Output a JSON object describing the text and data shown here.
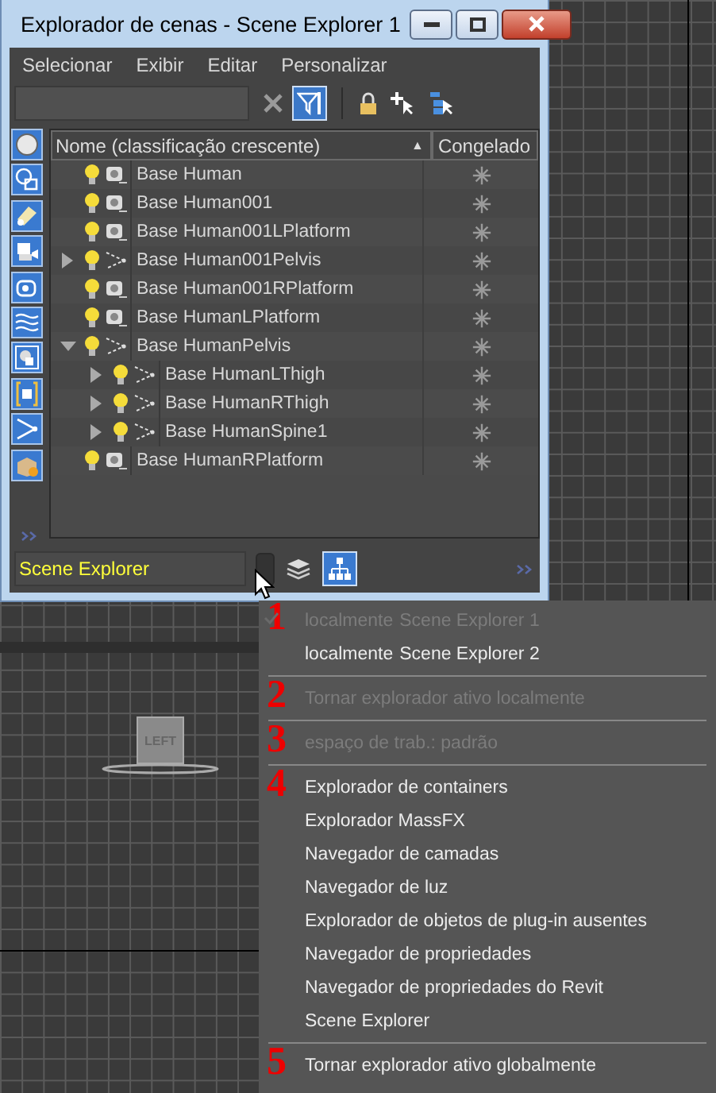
{
  "window": {
    "title": "Explorador de cenas - Scene Explorer 1"
  },
  "menubar": [
    "Selecionar",
    "Exibir",
    "Editar",
    "Personalizar"
  ],
  "toolbar": {
    "filter_on": true
  },
  "filters": [
    {
      "kind": "geometry",
      "on": true
    },
    {
      "kind": "shape",
      "on": true
    },
    {
      "kind": "light",
      "on": true
    },
    {
      "kind": "camera",
      "on": true
    },
    {
      "kind": "helper",
      "on": true
    },
    {
      "kind": "spacewarp",
      "on": true
    },
    {
      "kind": "group",
      "on": true
    },
    {
      "kind": "container",
      "on": true
    },
    {
      "kind": "bone",
      "on": true
    },
    {
      "kind": "xref",
      "on": true
    }
  ],
  "columns": [
    {
      "label": "Nome (classificação crescente)",
      "sort_mark": "▲"
    },
    {
      "label": "Congelado"
    }
  ],
  "rows": [
    {
      "name": "Base Human",
      "kind": "geometry",
      "frozen": false
    },
    {
      "name": "Base Human001",
      "kind": "geometry",
      "frozen": false
    },
    {
      "name": "Base Human001LPlatform",
      "kind": "geometry",
      "frozen": false
    },
    {
      "name": "Base Human001Pelvis",
      "kind": "bone",
      "frozen": false,
      "expanded": false
    },
    {
      "name": "Base Human001RPlatform",
      "kind": "geometry",
      "frozen": false
    },
    {
      "name": "Base HumanLPlatform",
      "kind": "geometry",
      "frozen": false
    },
    {
      "name": "Base HumanPelvis",
      "kind": "bone",
      "frozen": false,
      "expanded": true,
      "children": [
        {
          "name": "Base HumanLThigh",
          "kind": "bone",
          "frozen": false,
          "expanded": false
        },
        {
          "name": "Base HumanRThigh",
          "kind": "bone",
          "frozen": false,
          "expanded": false
        },
        {
          "name": "Base HumanSpine1",
          "kind": "bone",
          "frozen": false,
          "expanded": false
        }
      ]
    },
    {
      "name": "Base HumanRPlatform",
      "kind": "geometry",
      "frozen": false
    }
  ],
  "bottom": {
    "explorer_name": "Scene Explorer",
    "views": [
      {
        "kind": "layers",
        "selected": false
      },
      {
        "kind": "hierarchy",
        "selected": true
      }
    ]
  },
  "context_menu": [
    {
      "kind": "item",
      "marker": "1",
      "checked": true,
      "disabled": true,
      "prefix": "localmente",
      "label": "Scene Explorer 1"
    },
    {
      "kind": "item",
      "checked": false,
      "disabled": false,
      "prefix": "localmente",
      "label": "Scene Explorer 2"
    },
    {
      "kind": "separator"
    },
    {
      "kind": "item",
      "marker": "2",
      "checked": false,
      "disabled": true,
      "label": "Tornar explorador ativo localmente"
    },
    {
      "kind": "separator"
    },
    {
      "kind": "item",
      "marker": "3",
      "checked": false,
      "disabled": true,
      "label": "espaço de trab.: padrão"
    },
    {
      "kind": "separator"
    },
    {
      "kind": "item",
      "marker": "4",
      "checked": false,
      "disabled": false,
      "label": "Explorador de containers"
    },
    {
      "kind": "item",
      "checked": false,
      "disabled": false,
      "label": "Explorador MassFX"
    },
    {
      "kind": "item",
      "checked": false,
      "disabled": false,
      "label": "Navegador de camadas"
    },
    {
      "kind": "item",
      "checked": false,
      "disabled": false,
      "label": "Navegador de luz"
    },
    {
      "kind": "item",
      "checked": false,
      "disabled": false,
      "label": "Explorador de objetos de plug-in ausentes"
    },
    {
      "kind": "item",
      "checked": false,
      "disabled": false,
      "label": "Navegador de propriedades"
    },
    {
      "kind": "item",
      "checked": false,
      "disabled": false,
      "label": "Navegador de propriedades do Revit"
    },
    {
      "kind": "item",
      "checked": false,
      "disabled": false,
      "label": "Scene Explorer"
    },
    {
      "kind": "separator"
    },
    {
      "kind": "item",
      "marker": "5",
      "checked": false,
      "disabled": false,
      "label": "Tornar explorador ativo globalmente"
    }
  ],
  "viewcube": {
    "label": "LEFT"
  }
}
